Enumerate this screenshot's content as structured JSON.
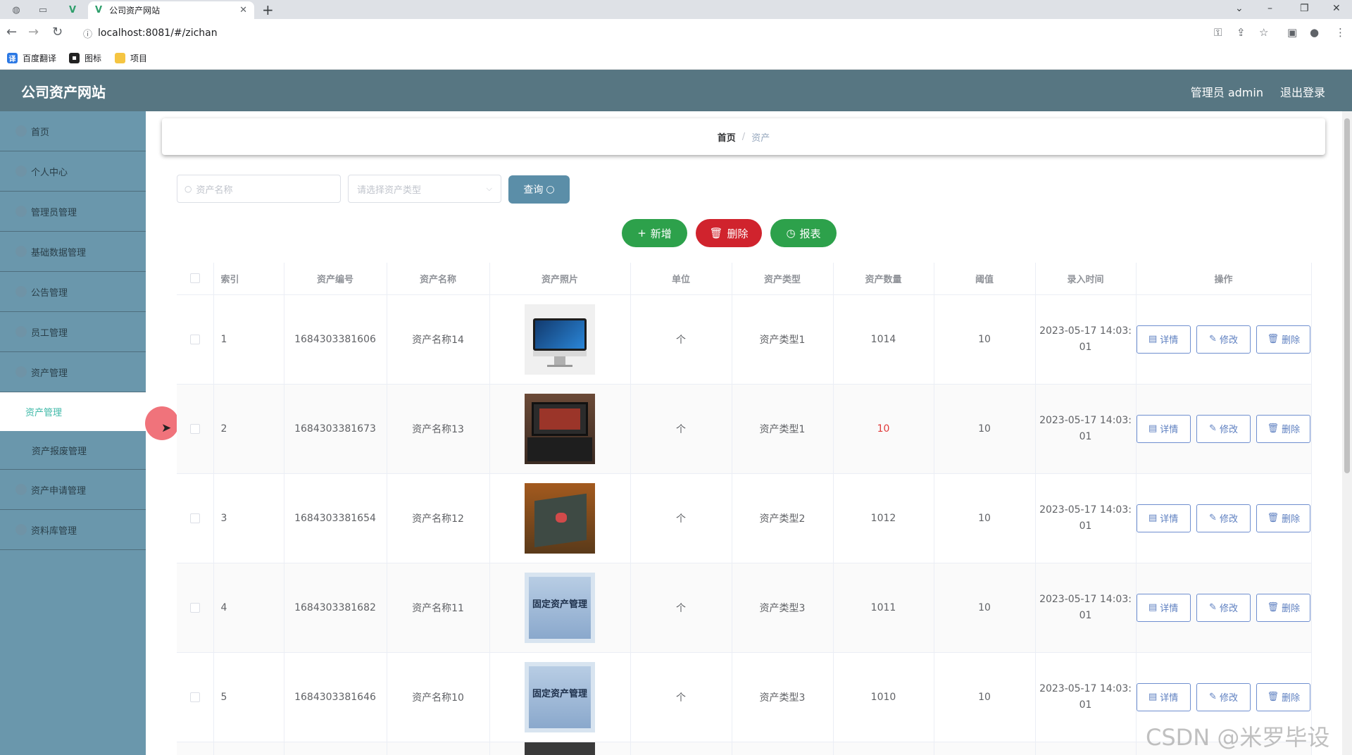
{
  "browser": {
    "tab_title": "公司资产网站",
    "url": "localhost:8081/#/zichan",
    "bookmarks": [
      "百度翻译",
      "图标",
      "项目"
    ]
  },
  "app": {
    "title": "公司资产网站",
    "user_label": "管理员 admin",
    "logout_label": "退出登录"
  },
  "sidebar": {
    "items": [
      {
        "label": "首页"
      },
      {
        "label": "个人中心"
      },
      {
        "label": "管理员管理"
      },
      {
        "label": "基础数据管理"
      },
      {
        "label": "公告管理"
      },
      {
        "label": "员工管理"
      },
      {
        "label": "资产管理"
      }
    ],
    "subitems": [
      {
        "label": "资产管理",
        "active": true
      },
      {
        "label": "资产报废管理"
      }
    ],
    "items_after": [
      {
        "label": "资产申请管理"
      },
      {
        "label": "资料库管理"
      }
    ]
  },
  "breadcrumb": {
    "home": "首页",
    "separator": "/",
    "current": "资产"
  },
  "search": {
    "name_placeholder": "资产名称",
    "type_placeholder": "请选择资产类型",
    "query_label": "查询"
  },
  "actions": {
    "add": "新增",
    "delete": "删除",
    "report": "报表"
  },
  "table": {
    "headers": [
      "索引",
      "资产编号",
      "资产名称",
      "资产照片",
      "单位",
      "资产类型",
      "资产数量",
      "阈值",
      "录入时间",
      "操作"
    ],
    "row_buttons": {
      "detail": "详情",
      "edit": "修改",
      "delete": "删除"
    },
    "rows": [
      {
        "index": "1",
        "code": "1684303381606",
        "name": "资产名称14",
        "photo": "monitor",
        "unit": "个",
        "type": "资产类型1",
        "qty": "1014",
        "threshold": "10",
        "time_a": "2023-05-17 14:03:",
        "time_b": "01"
      },
      {
        "index": "2",
        "code": "1684303381673",
        "name": "资产名称13",
        "photo": "laptop",
        "unit": "个",
        "type": "资产类型1",
        "qty": "10",
        "threshold": "10",
        "time_a": "2023-05-17 14:03:",
        "time_b": "01"
      },
      {
        "index": "3",
        "code": "1684303381654",
        "name": "资产名称12",
        "photo": "rog-laptop",
        "unit": "个",
        "type": "资产类型2",
        "qty": "1012",
        "threshold": "10",
        "time_a": "2023-05-17 14:03:",
        "time_b": "01"
      },
      {
        "index": "4",
        "code": "1684303381682",
        "name": "资产名称11",
        "photo": "fixed-asset",
        "photo_text": "固定资产管理",
        "unit": "个",
        "type": "资产类型3",
        "qty": "1011",
        "threshold": "10",
        "time_a": "2023-05-17 14:03:",
        "time_b": "01"
      },
      {
        "index": "5",
        "code": "1684303381646",
        "name": "资产名称10",
        "photo": "fixed-asset",
        "photo_text": "固定资产管理",
        "unit": "个",
        "type": "资产类型3",
        "qty": "1010",
        "threshold": "10",
        "time_a": "2023-05-17 14:03:",
        "time_b": "01"
      }
    ]
  },
  "watermark": "CSDN @米罗毕设",
  "colors": {
    "header": "#577682",
    "sidebar": "#6a97ac",
    "success": "#2da14b",
    "danger": "#d0232d",
    "active_menu": "#3fb9a8"
  }
}
